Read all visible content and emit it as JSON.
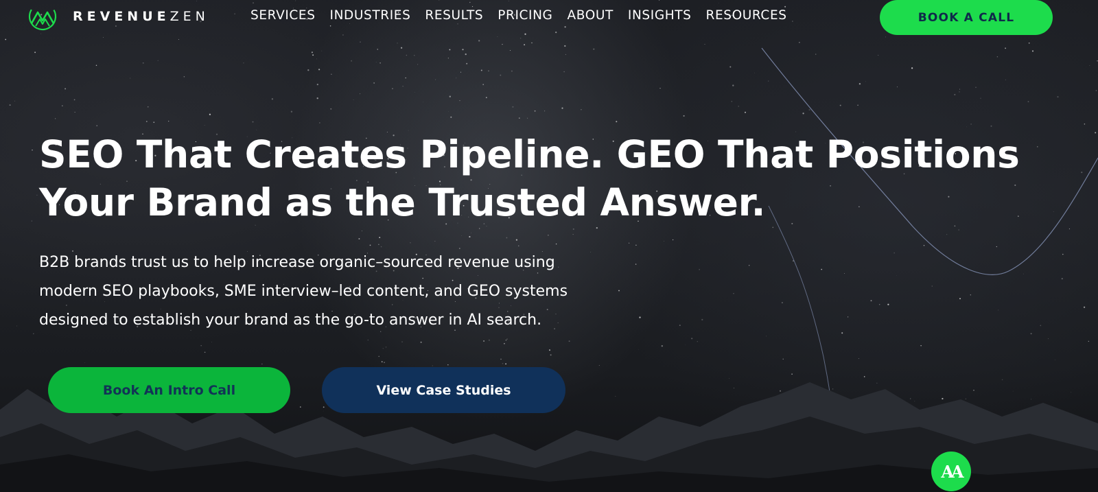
{
  "brand": {
    "name_bold": "REVENUE",
    "name_light": "ZEN",
    "logo_icon": "mountain-peak-logo-icon",
    "accent_color": "#1ddc4c"
  },
  "nav": {
    "items": [
      {
        "label": "SERVICES"
      },
      {
        "label": "INDUSTRIES"
      },
      {
        "label": "RESULTS"
      },
      {
        "label": "PRICING"
      },
      {
        "label": "ABOUT"
      },
      {
        "label": "INSIGHTS"
      },
      {
        "label": "RESOURCES"
      }
    ],
    "cta_label": "BOOK A CALL"
  },
  "hero": {
    "title_line1": "SEO That Creates Pipeline. GEO That Positions",
    "title_line2": "Your Brand as the Trusted Answer.",
    "subtitle_line1": "B2B brands trust us to help increase organic–sourced revenue using",
    "subtitle_line2": "modern SEO playbooks, SME interview–led content, and GEO systems",
    "subtitle_line3": "designed to establish your brand as the go-to answer in AI search.",
    "primary_cta": "Book An Intro Call",
    "secondary_cta": "View Case Studies"
  },
  "accessibility_widget": {
    "label": "AA",
    "icon": "accessibility-icon"
  },
  "colors": {
    "primary_button": "#0bb53b",
    "secondary_button": "#10315a",
    "background": "#1d1f24"
  }
}
